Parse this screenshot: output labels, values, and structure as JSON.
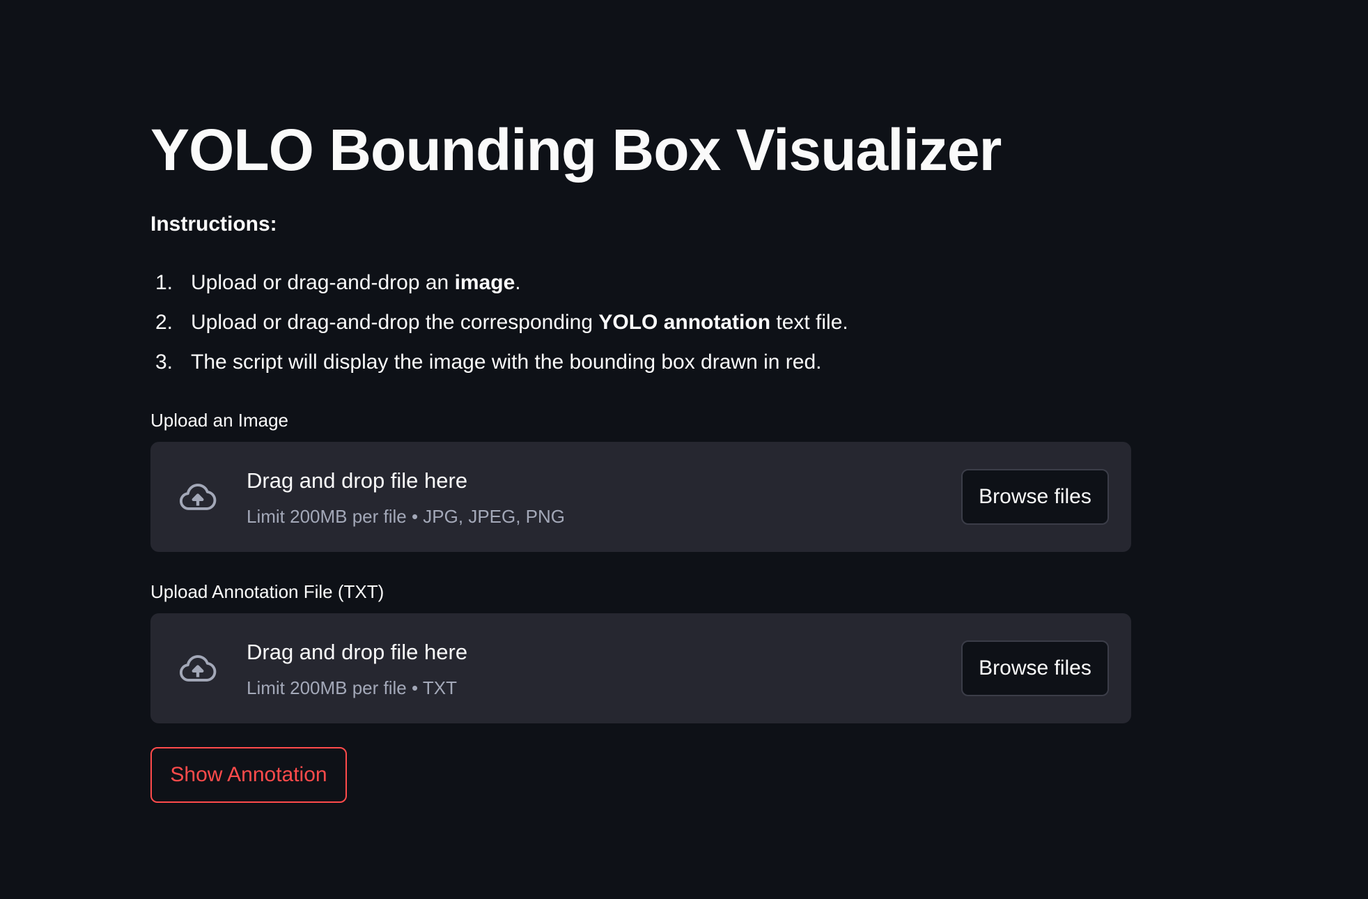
{
  "page": {
    "title": "YOLO Bounding Box Visualizer",
    "instructions_heading": "Instructions:"
  },
  "steps": [
    {
      "num": "1.",
      "before": "Upload or drag-and-drop an ",
      "bold": "image",
      "after": "."
    },
    {
      "num": "2.",
      "before": "Upload or drag-and-drop the corresponding ",
      "bold": "YOLO annotation",
      "after": " text file."
    },
    {
      "num": "3.",
      "before": "The script will display the image with the bounding box drawn in red.",
      "bold": "",
      "after": ""
    }
  ],
  "image_uploader": {
    "label": "Upload an Image",
    "drop_text": "Drag and drop file here",
    "limit_text": "Limit 200MB per file • JPG, JPEG, PNG",
    "browse_label": "Browse files",
    "icon": "cloud-upload-icon"
  },
  "annotation_uploader": {
    "label": "Upload Annotation File (TXT)",
    "drop_text": "Drag and drop file here",
    "limit_text": "Limit 200MB per file • TXT",
    "browse_label": "Browse files",
    "icon": "cloud-upload-icon"
  },
  "show_button": {
    "label": "Show Annotation"
  },
  "colors": {
    "background": "#0e1117",
    "dropzone": "#262730",
    "accent": "#ff4b4b",
    "muted_text": "#a3a8b8",
    "text": "#fafafa"
  }
}
